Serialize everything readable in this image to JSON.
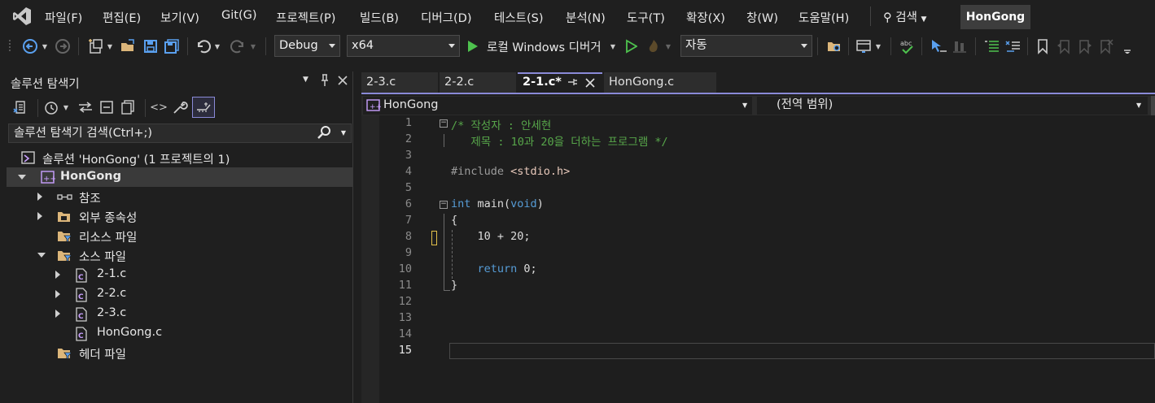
{
  "menubar": {
    "items": [
      "파일(F)",
      "편집(E)",
      "보기(V)",
      "Git(G)",
      "프로젝트(P)",
      "빌드(B)",
      "디버그(D)",
      "테스트(S)",
      "분석(N)",
      "도구(T)",
      "확장(X)",
      "창(W)",
      "도움말(H)"
    ],
    "search_label": "검색",
    "profile": "HonGong",
    "logo_icon": "visual-studio-logo-icon"
  },
  "toolbar": {
    "config": "Debug",
    "platform": "x64",
    "run_label": "로컬 Windows 디버거",
    "auto_label": "자동"
  },
  "solution_explorer": {
    "title": "솔루션 탐색기",
    "search_placeholder": "솔루션 탐색기 검색(Ctrl+;)",
    "tree": [
      {
        "label": "솔루션 'HonGong' (1 프로젝트의 1)",
        "level": 0,
        "icon": "solution-icon",
        "expander": ""
      },
      {
        "label": "HonGong",
        "level": 0,
        "icon": "cpp-project-icon",
        "expander": "down",
        "selected": true,
        "bold": true
      },
      {
        "label": "참조",
        "level": 1,
        "icon": "references-icon",
        "expander": "right"
      },
      {
        "label": "외부 종속성",
        "level": 1,
        "icon": "external-deps-icon",
        "expander": "right"
      },
      {
        "label": "리소스 파일",
        "level": 1,
        "icon": "filter-folder-icon",
        "expander": ""
      },
      {
        "label": "소스 파일",
        "level": 1,
        "icon": "filter-folder-icon",
        "expander": "down"
      },
      {
        "label": "2-1.c",
        "level": 2,
        "icon": "c-file-icon",
        "expander": "right"
      },
      {
        "label": "2-2.c",
        "level": 2,
        "icon": "c-file-icon",
        "expander": "right"
      },
      {
        "label": "2-3.c",
        "level": 2,
        "icon": "c-file-icon",
        "expander": "right"
      },
      {
        "label": "HonGong.c",
        "level": 2,
        "icon": "c-file-icon",
        "expander": ""
      },
      {
        "label": "헤더 파일",
        "level": 1,
        "icon": "filter-folder-icon",
        "expander": ""
      }
    ]
  },
  "editor": {
    "tabs": [
      {
        "label": "2-3.c",
        "active": false
      },
      {
        "label": "2-2.c",
        "active": false
      },
      {
        "label": "2-1.c*",
        "active": true
      },
      {
        "label": "HonGong.c",
        "active": false
      }
    ],
    "nav_project": "HonGong",
    "nav_scope": "(전역 범위)",
    "current_line": 15,
    "lines": [
      {
        "n": "1",
        "parts": [
          {
            "t": "/* 작성자 : 안세현",
            "c": "cm"
          }
        ]
      },
      {
        "n": "2",
        "parts": [
          {
            "t": "   제목 : 10과 20을 더하는 프로그램 */",
            "c": "cm"
          }
        ]
      },
      {
        "n": "3",
        "parts": []
      },
      {
        "n": "4",
        "parts": [
          {
            "t": "#include ",
            "c": "pp"
          },
          {
            "t": "<stdio.h>",
            "c": "inc"
          }
        ]
      },
      {
        "n": "5",
        "parts": []
      },
      {
        "n": "6",
        "parts": [
          {
            "t": "int",
            "c": "kw"
          },
          {
            "t": " main(",
            "c": ""
          },
          {
            "t": "void",
            "c": "kw"
          },
          {
            "t": ")",
            "c": ""
          }
        ]
      },
      {
        "n": "7",
        "parts": [
          {
            "t": "{",
            "c": ""
          }
        ]
      },
      {
        "n": "8",
        "parts": [
          {
            "t": "    10 + 20;",
            "c": ""
          }
        ]
      },
      {
        "n": "9",
        "parts": []
      },
      {
        "n": "10",
        "parts": [
          {
            "t": "    return ",
            "c": "kw"
          },
          {
            "t": "0;",
            "c": ""
          }
        ]
      },
      {
        "n": "11",
        "parts": [
          {
            "t": "}",
            "c": ""
          }
        ]
      },
      {
        "n": "12",
        "parts": []
      },
      {
        "n": "13",
        "parts": []
      },
      {
        "n": "14",
        "parts": []
      },
      {
        "n": "15",
        "parts": []
      }
    ]
  }
}
